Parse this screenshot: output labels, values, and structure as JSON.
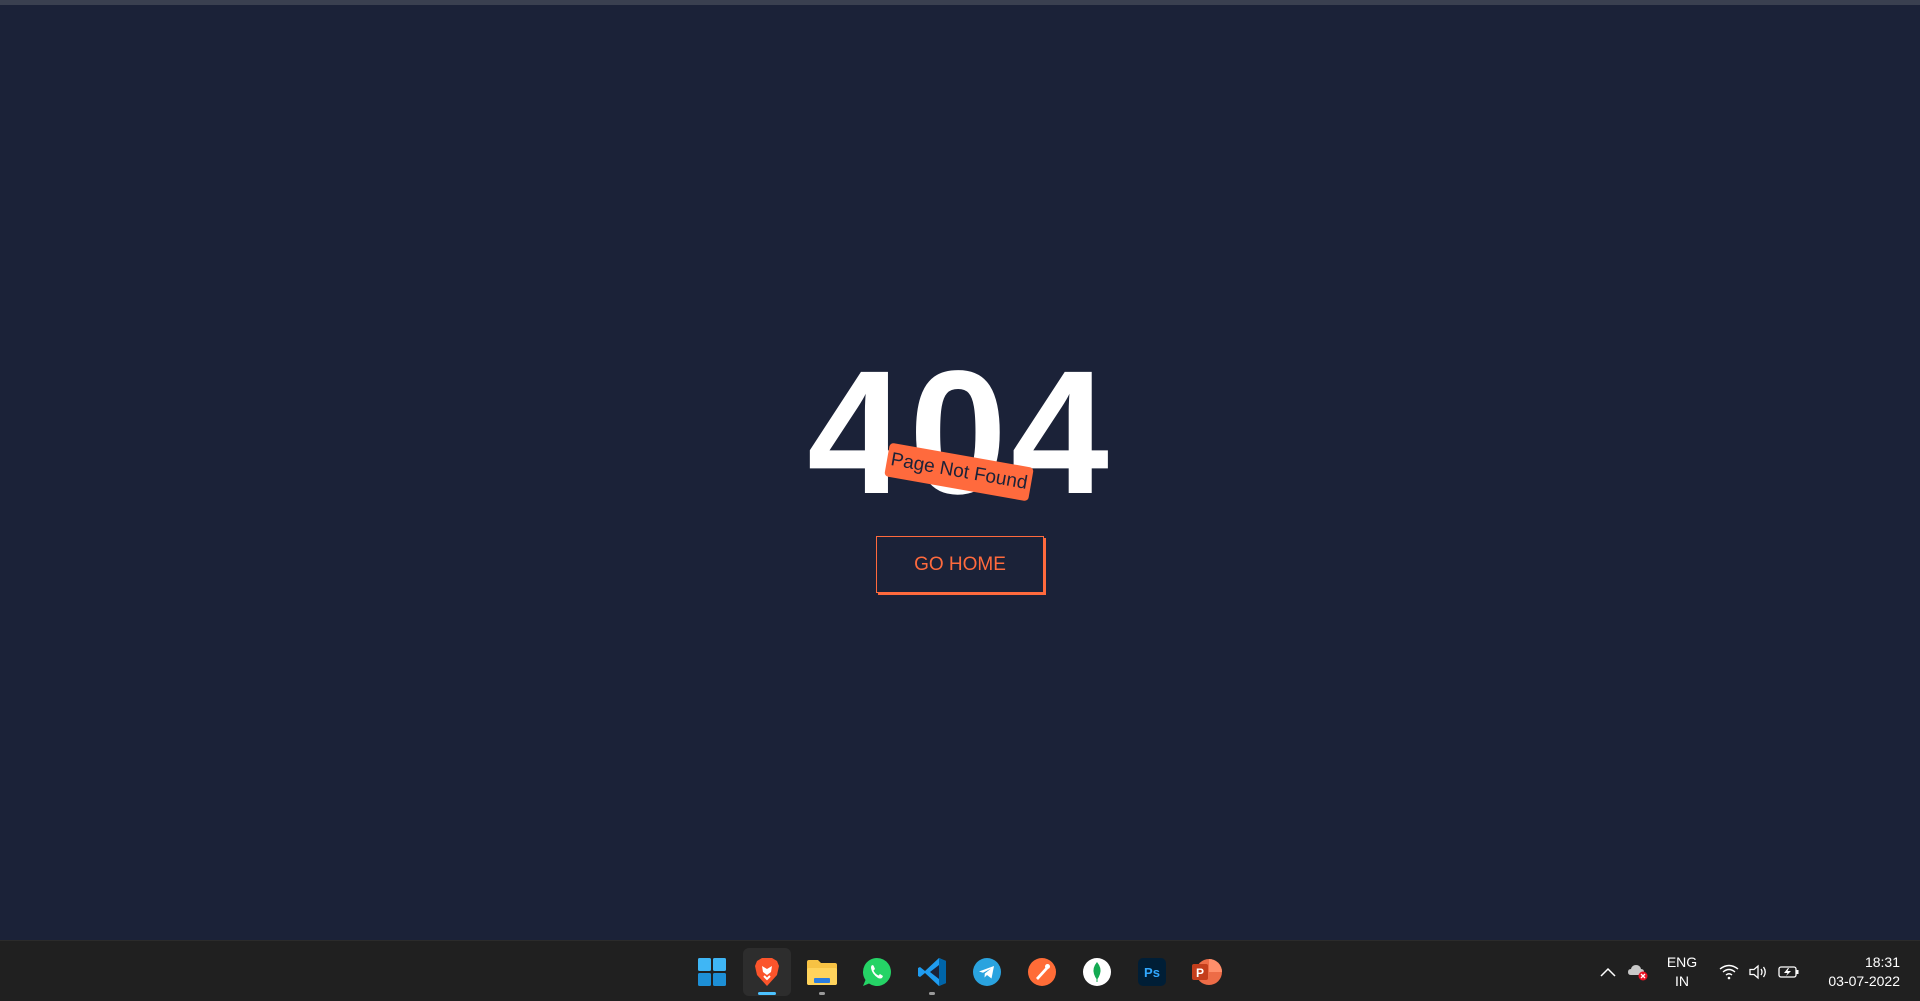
{
  "page": {
    "error_code": "404",
    "ribbon_text": "Page Not Found",
    "button_label": "GO HOME",
    "colors": {
      "background": "#1b2238",
      "accent": "#ff6a3d",
      "text": "#ffffff"
    }
  },
  "taskbar": {
    "apps": [
      {
        "name": "start",
        "icon": "windows-start-icon",
        "active": false,
        "running": false
      },
      {
        "name": "brave",
        "icon": "brave-browser-icon",
        "active": true,
        "running": true
      },
      {
        "name": "file-explorer",
        "icon": "file-explorer-icon",
        "active": false,
        "running": true
      },
      {
        "name": "whatsapp",
        "icon": "whatsapp-icon",
        "active": false,
        "running": false
      },
      {
        "name": "vscode",
        "icon": "vscode-icon",
        "active": false,
        "running": true
      },
      {
        "name": "telegram",
        "icon": "telegram-icon",
        "active": false,
        "running": false
      },
      {
        "name": "postman",
        "icon": "postman-icon",
        "active": false,
        "running": false
      },
      {
        "name": "mongodb-compass",
        "icon": "mongodb-icon",
        "active": false,
        "running": false
      },
      {
        "name": "photoshop",
        "icon": "photoshop-icon",
        "active": false,
        "running": false
      },
      {
        "name": "powerpoint",
        "icon": "powerpoint-icon",
        "active": false,
        "running": false
      }
    ],
    "photoshop_label": "Ps",
    "powerpoint_label": "P",
    "tray": {
      "language": "ENG",
      "region": "IN",
      "time": "18:31",
      "date": "03-07-2022",
      "icons": [
        "chevron-up-icon",
        "onedrive-error-icon",
        "wifi-icon",
        "volume-icon",
        "battery-icon"
      ]
    }
  }
}
